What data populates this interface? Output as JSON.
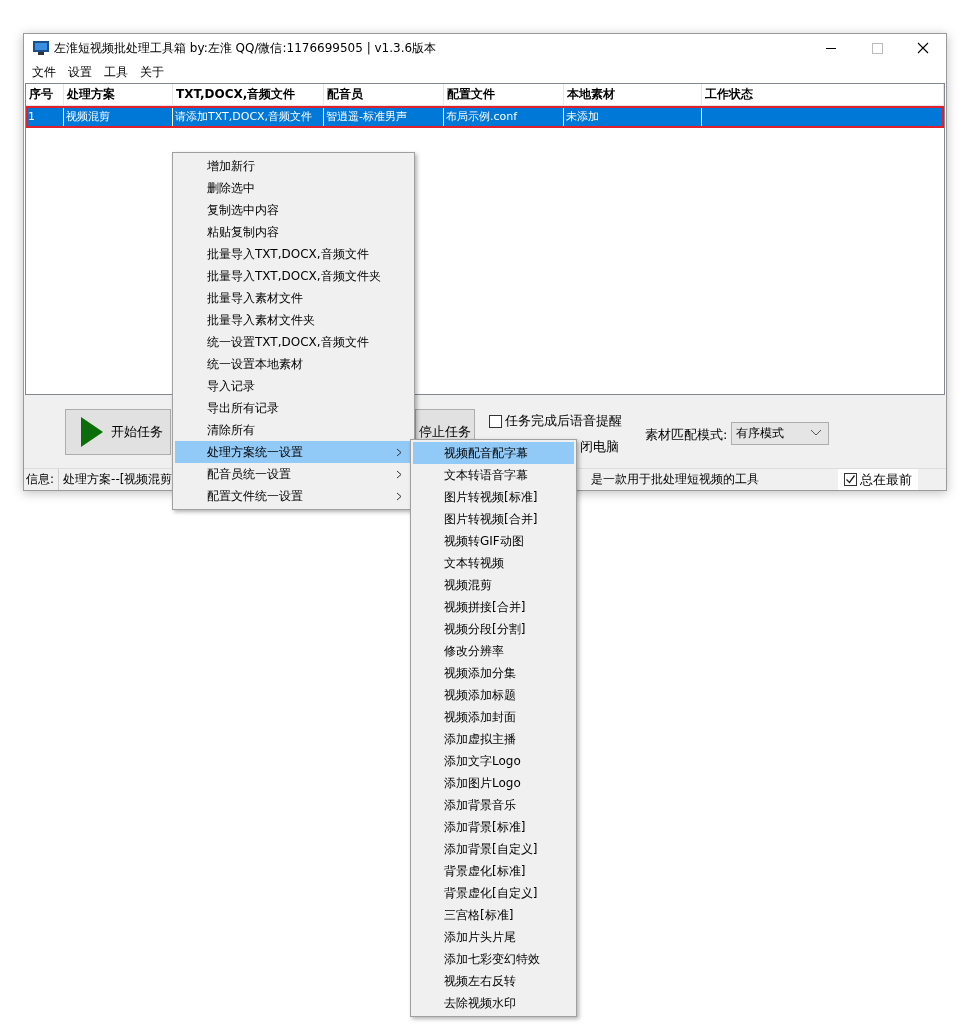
{
  "window": {
    "title": "左淮短视频批处理工具箱  by:左淮 QQ/微信:1176699505 | v1.3.6版本"
  },
  "menu_bar": [
    "文件",
    "设置",
    "工具",
    "关于"
  ],
  "table": {
    "columns": [
      "序号",
      "处理方案",
      "TXT,DOCX,音频文件",
      "配音员",
      "配置文件",
      "本地素材",
      "工作状态"
    ],
    "rows": [
      {
        "cells": [
          "1",
          "视频混剪",
          "请添加TXT,DOCX,音频文件",
          "智逍遥-标准男声",
          "布局示例.conf",
          "未添加",
          ""
        ],
        "selected": true
      }
    ]
  },
  "controls": {
    "start_button": "开始任务",
    "stop_button": "停止任务",
    "voice_alert": {
      "label": "任务完成后语音提醒",
      "checked": false
    },
    "shutdown_label": "闭电脑",
    "match_mode": {
      "label": "素材匹配模式:",
      "value": "有序模式"
    }
  },
  "status_bar": {
    "label": "信息:",
    "text_left": "处理方案--[视频混剪",
    "text_right": "是一款用于批处理短视频的工具",
    "always_on_top": {
      "label": "总在最前",
      "checked": true
    }
  },
  "context_menu": {
    "items": [
      {
        "label": "增加新行",
        "has_submenu": false,
        "selected": false
      },
      {
        "label": "删除选中",
        "has_submenu": false,
        "selected": false
      },
      {
        "label": "复制选中内容",
        "has_submenu": false,
        "selected": false
      },
      {
        "label": "粘贴复制内容",
        "has_submenu": false,
        "selected": false
      },
      {
        "label": "批量导入TXT,DOCX,音频文件",
        "has_submenu": false,
        "selected": false
      },
      {
        "label": "批量导入TXT,DOCX,音频文件夹",
        "has_submenu": false,
        "selected": false
      },
      {
        "label": "批量导入素材文件",
        "has_submenu": false,
        "selected": false
      },
      {
        "label": "批量导入素材文件夹",
        "has_submenu": false,
        "selected": false
      },
      {
        "label": "统一设置TXT,DOCX,音频文件",
        "has_submenu": false,
        "selected": false
      },
      {
        "label": "统一设置本地素材",
        "has_submenu": false,
        "selected": false
      },
      {
        "label": "导入记录",
        "has_submenu": false,
        "selected": false
      },
      {
        "label": "导出所有记录",
        "has_submenu": false,
        "selected": false
      },
      {
        "label": "清除所有",
        "has_submenu": false,
        "selected": false
      },
      {
        "label": "处理方案统一设置",
        "has_submenu": true,
        "selected": true
      },
      {
        "label": "配音员统一设置",
        "has_submenu": true,
        "selected": false
      },
      {
        "label": "配置文件统一设置",
        "has_submenu": true,
        "selected": false
      }
    ]
  },
  "submenu": {
    "items": [
      {
        "label": "视频配音配字幕",
        "selected": true
      },
      {
        "label": "文本转语音字幕",
        "selected": false
      },
      {
        "label": "图片转视频[标准]",
        "selected": false
      },
      {
        "label": "图片转视频[合并]",
        "selected": false
      },
      {
        "label": "视频转GIF动图",
        "selected": false
      },
      {
        "label": "文本转视频",
        "selected": false
      },
      {
        "label": "视频混剪",
        "selected": false
      },
      {
        "label": "视频拼接[合并]",
        "selected": false
      },
      {
        "label": "视频分段[分割]",
        "selected": false
      },
      {
        "label": "修改分辨率",
        "selected": false
      },
      {
        "label": "视频添加分集",
        "selected": false
      },
      {
        "label": "视频添加标题",
        "selected": false
      },
      {
        "label": "视频添加封面",
        "selected": false
      },
      {
        "label": "添加虚拟主播",
        "selected": false
      },
      {
        "label": "添加文字Logo",
        "selected": false
      },
      {
        "label": "添加图片Logo",
        "selected": false
      },
      {
        "label": "添加背景音乐",
        "selected": false
      },
      {
        "label": "添加背景[标准]",
        "selected": false
      },
      {
        "label": "添加背景[自定义]",
        "selected": false
      },
      {
        "label": "背景虚化[标准]",
        "selected": false
      },
      {
        "label": "背景虚化[自定义]",
        "selected": false
      },
      {
        "label": "三宫格[标准]",
        "selected": false
      },
      {
        "label": "添加片头片尾",
        "selected": false
      },
      {
        "label": "添加七彩变幻特效",
        "selected": false
      },
      {
        "label": "视频左右反转",
        "selected": false
      },
      {
        "label": "去除视频水印",
        "selected": false
      }
    ]
  }
}
